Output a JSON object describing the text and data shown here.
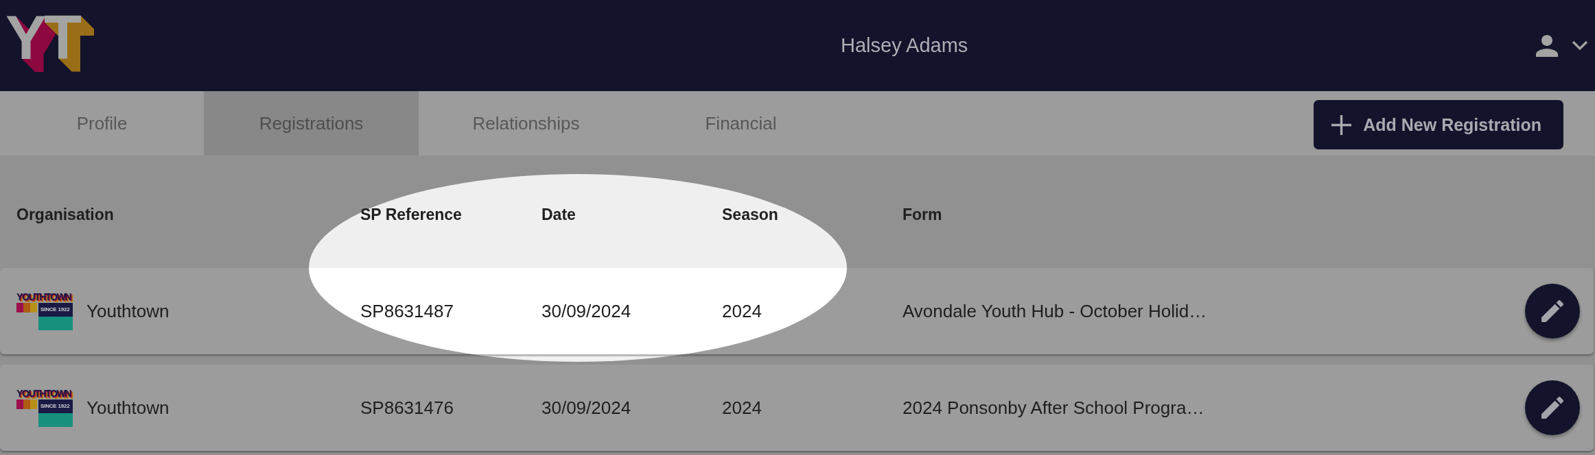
{
  "header": {
    "logo": "YT",
    "user_name": "Halsey Adams"
  },
  "tabs": [
    {
      "label": "Profile",
      "selected": false
    },
    {
      "label": "Registrations",
      "selected": true
    },
    {
      "label": "Relationships",
      "selected": false
    },
    {
      "label": "Financial",
      "selected": false
    }
  ],
  "add_button": {
    "label": "Add New Registration"
  },
  "table": {
    "columns": [
      "Organisation",
      "SP Reference",
      "Date",
      "Season",
      "Form"
    ],
    "rows": [
      {
        "organisation_logo": {
          "wordmark": "YOUTHTOWN",
          "tagline": "SINCE 1922"
        },
        "organisation": "Youthtown",
        "sp_reference": "SP8631487",
        "date": "30/09/2024",
        "season": "2024",
        "form": "Avondale Youth Hub - October Holid…"
      },
      {
        "organisation_logo": {
          "wordmark": "YOUTHTOWN",
          "tagline": "SINCE 1922"
        },
        "organisation": "Youthtown",
        "sp_reference": "SP8631476",
        "date": "30/09/2024",
        "season": "2024",
        "form": "2024 Ponsonby After School Progra…"
      }
    ]
  }
}
